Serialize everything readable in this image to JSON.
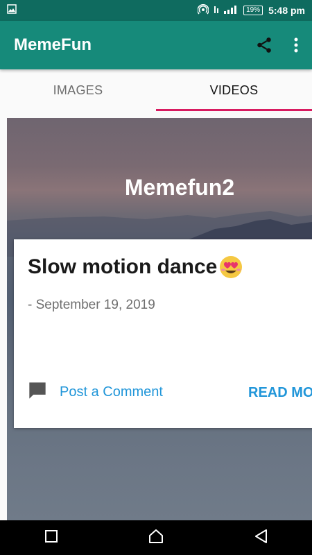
{
  "status_bar": {
    "battery": "19%",
    "time": "5:48 pm"
  },
  "app_bar": {
    "title": "MemeFun"
  },
  "tabs": [
    {
      "label": "IMAGES",
      "active": false
    },
    {
      "label": "VIDEOS",
      "active": true
    }
  ],
  "blog": {
    "title": "Memefun2"
  },
  "post": {
    "title": "Slow motion dance",
    "emoji": "smiling-face-with-heart-eyes",
    "date": "- September 19, 2019",
    "comment_label": "Post a Comment",
    "read_more_label": "READ MORE"
  },
  "colors": {
    "status_bar": "#0f6b5f",
    "app_bar": "#168a7a",
    "tab_indicator": "#d81b60",
    "link": "#2196d9"
  }
}
